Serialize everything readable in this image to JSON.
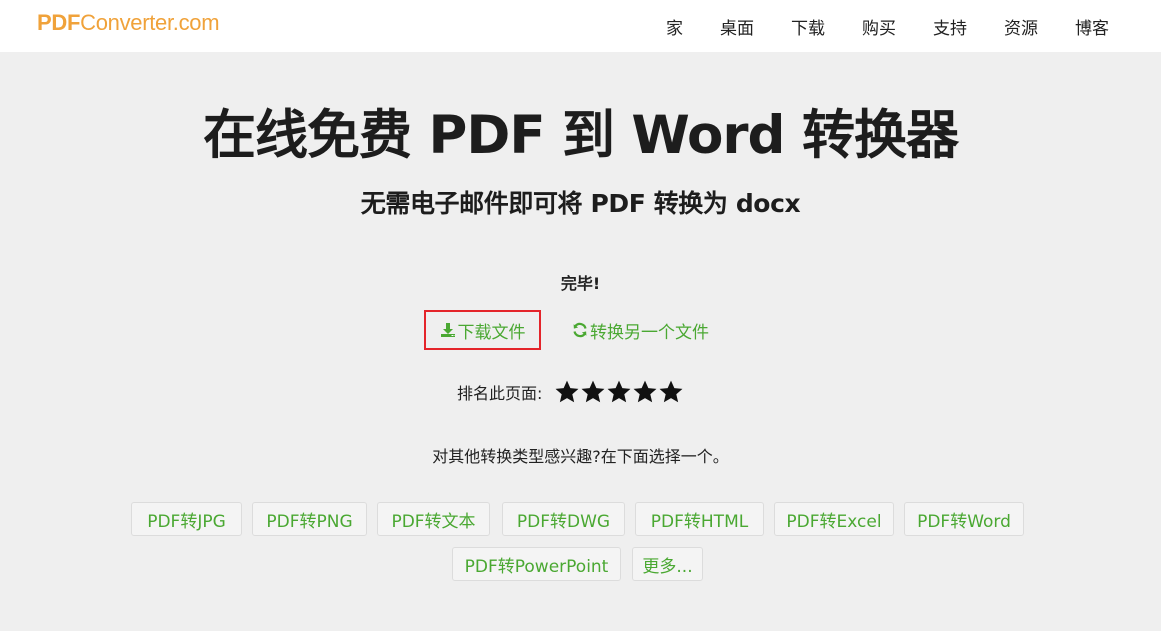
{
  "header": {
    "logo_prefix": "PDF",
    "logo_suffix": "Converter.com",
    "nav": [
      "家",
      "桌面",
      "下载",
      "购买",
      "支持",
      "资源",
      "博客"
    ]
  },
  "hero": {
    "title": "在线免费 PDF 到 Word 转换器",
    "subtitle": "无需电子邮件即可将 PDF 转换为 docx"
  },
  "result": {
    "status": "完毕!",
    "download_label": "下载文件",
    "convert_another_label": "转换另一个文件",
    "download_icon": "download-icon",
    "refresh_icon": "refresh-icon"
  },
  "rating": {
    "label": "排名此页面:",
    "stars": 5,
    "star_icon": "star-icon"
  },
  "more": {
    "prompt": "对其他转换类型感兴趣?在下面选择一个。",
    "chips": [
      "PDF转JPG",
      "PDF转PNG",
      "PDF转文本",
      "PDF转DWG",
      "PDF转HTML",
      "PDF转Excel",
      "PDF转Word",
      "PDF转PowerPoint",
      "更多..."
    ]
  },
  "colors": {
    "brand": "#f0a23a",
    "link_green": "#4aa832",
    "highlight_red": "#e4242a",
    "background": "#efefef"
  }
}
